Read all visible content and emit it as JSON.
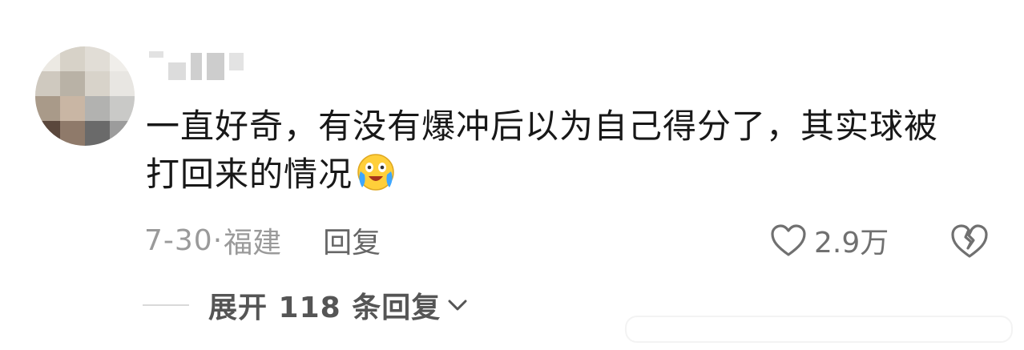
{
  "comment": {
    "text_line1": "一直好奇，有没有爆冲后以为自己得分了，其实球被",
    "text_line2": "打回来的情况",
    "emoji": "crying-laughing-emoji",
    "date": "7-30",
    "separator": "·",
    "location": "福建",
    "reply_label": "回复",
    "like_count": "2.9万",
    "expand_label": "展开 118 条回复"
  },
  "colors": {
    "text": "#181818",
    "meta": "#9a9a9a",
    "icon": "#707070",
    "emoji_face": "#ffcf3a",
    "emoji_tear": "#3ea7ff"
  }
}
